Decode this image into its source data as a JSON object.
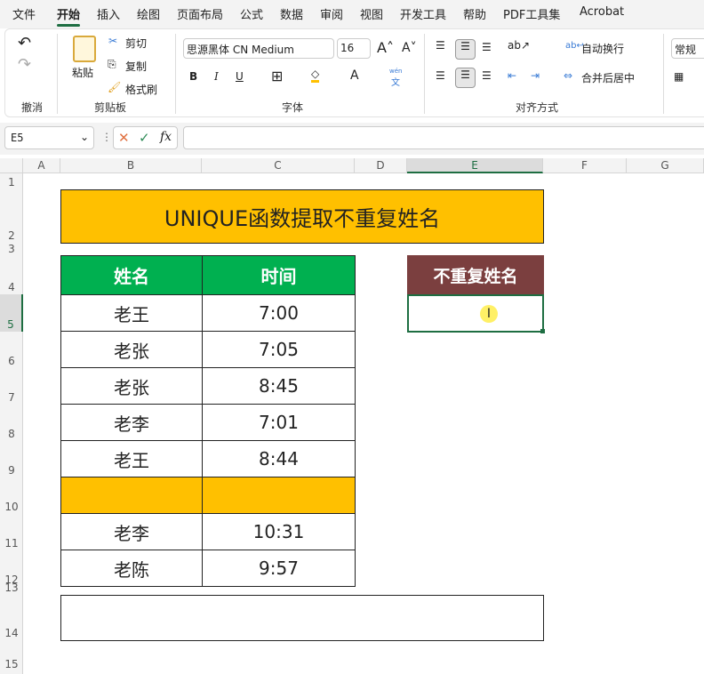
{
  "menu": {
    "tabs": [
      "文件",
      "开始",
      "插入",
      "绘图",
      "页面布局",
      "公式",
      "数据",
      "审阅",
      "视图",
      "开发工具",
      "帮助",
      "PDF工具集",
      "Acrobat"
    ]
  },
  "ribbon": {
    "undo_group": "撤消",
    "clipboard": {
      "paste": "粘贴",
      "cut": "剪切",
      "copy": "复制",
      "format_painter": "格式刷",
      "label": "剪贴板"
    },
    "font": {
      "name": "思源黑体 CN Medium",
      "size": "16",
      "bold": "B",
      "italic": "I",
      "underline": "U",
      "phonetic": "文",
      "phonetic_top": "wén",
      "label": "字体"
    },
    "alignment": {
      "wrap": "自动换行",
      "merge": "合并后居中",
      "label": "对齐方式"
    },
    "number": {
      "format": "常规"
    }
  },
  "formula_bar": {
    "name_box": "E5",
    "fx": "fx",
    "value": ""
  },
  "columns": [
    "A",
    "B",
    "C",
    "D",
    "E",
    "F",
    "G"
  ],
  "rows": [
    "1",
    "2",
    "3",
    "4",
    "5",
    "6",
    "7",
    "8",
    "9",
    "10",
    "11",
    "12",
    "13",
    "14",
    "15"
  ],
  "sheet": {
    "title": "UNIQUE函数提取不重复姓名",
    "headers": [
      "姓名",
      "时间"
    ],
    "data": [
      [
        "老王",
        "7:00"
      ],
      [
        "老张",
        "7:05"
      ],
      [
        "老张",
        "8:45"
      ],
      [
        "老李",
        "7:01"
      ],
      [
        "老王",
        "8:44"
      ],
      [
        "",
        ""
      ],
      [
        "老李",
        "10:31"
      ],
      [
        "老陈",
        "9:57"
      ]
    ],
    "result_header": "不重复姓名",
    "result_value": ""
  },
  "colors": {
    "title_bg": "#ffc000",
    "header_green": "#00b050",
    "result_header": "#7b3f3f",
    "accent": "#1e6e42"
  }
}
